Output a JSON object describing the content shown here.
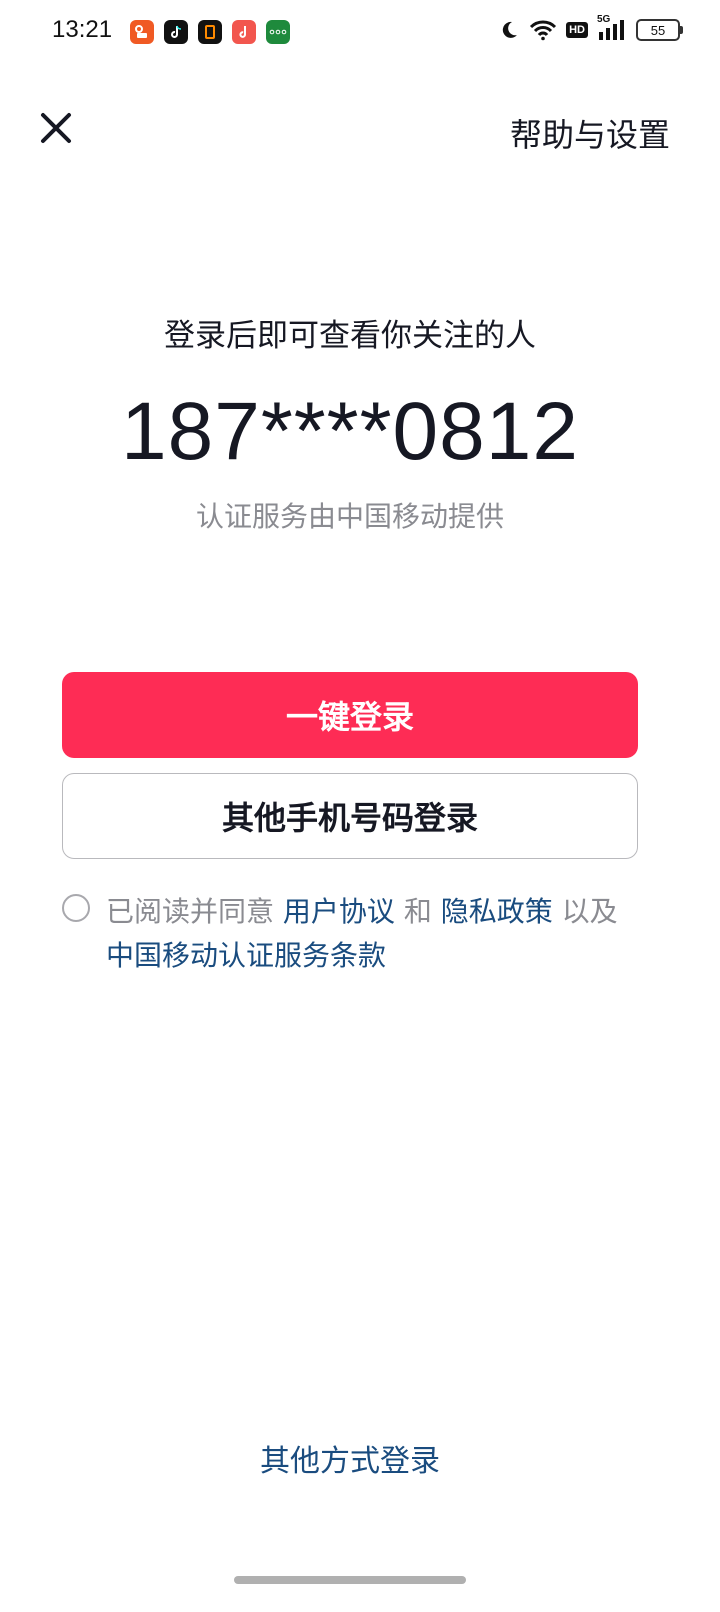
{
  "status_bar": {
    "time": "13:21",
    "notification_apps": [
      {
        "name": "kuaishou-app-icon",
        "color": "#f05a24",
        "glyph": "◉"
      },
      {
        "name": "douyin-app-icon",
        "color": "#111111",
        "glyph": "♪"
      },
      {
        "name": "orange-box-app-icon",
        "color": "#111111",
        "glyph": "▯"
      },
      {
        "name": "music-app-icon",
        "color": "#f2564e",
        "glyph": "♪"
      },
      {
        "name": "green-app-icon",
        "color": "#1e8a3c",
        "glyph": "◦◦◦"
      }
    ],
    "hd_label": "HD",
    "network_label": "5G",
    "battery_level": "55"
  },
  "header": {
    "help_label": "帮助与设置"
  },
  "main": {
    "subtitle": "登录后即可查看你关注的人",
    "phone_number": "187****0812",
    "provider_note": "认证服务由中国移动提供",
    "one_click_login_label": "一键登录",
    "other_phone_login_label": "其他手机号码登录"
  },
  "agreement": {
    "prefix": "已阅读并同意 ",
    "user_agreement": "用户协议",
    "and": " 和 ",
    "privacy_policy": "隐私政策",
    "also": " 以及 ",
    "cmcc_terms": "中国移动认证服务条款"
  },
  "footer": {
    "other_methods_label": "其他方式登录"
  },
  "colors": {
    "primary": "#fe2c55",
    "link": "#1a4c7f",
    "muted_text": "#8a8b91"
  }
}
